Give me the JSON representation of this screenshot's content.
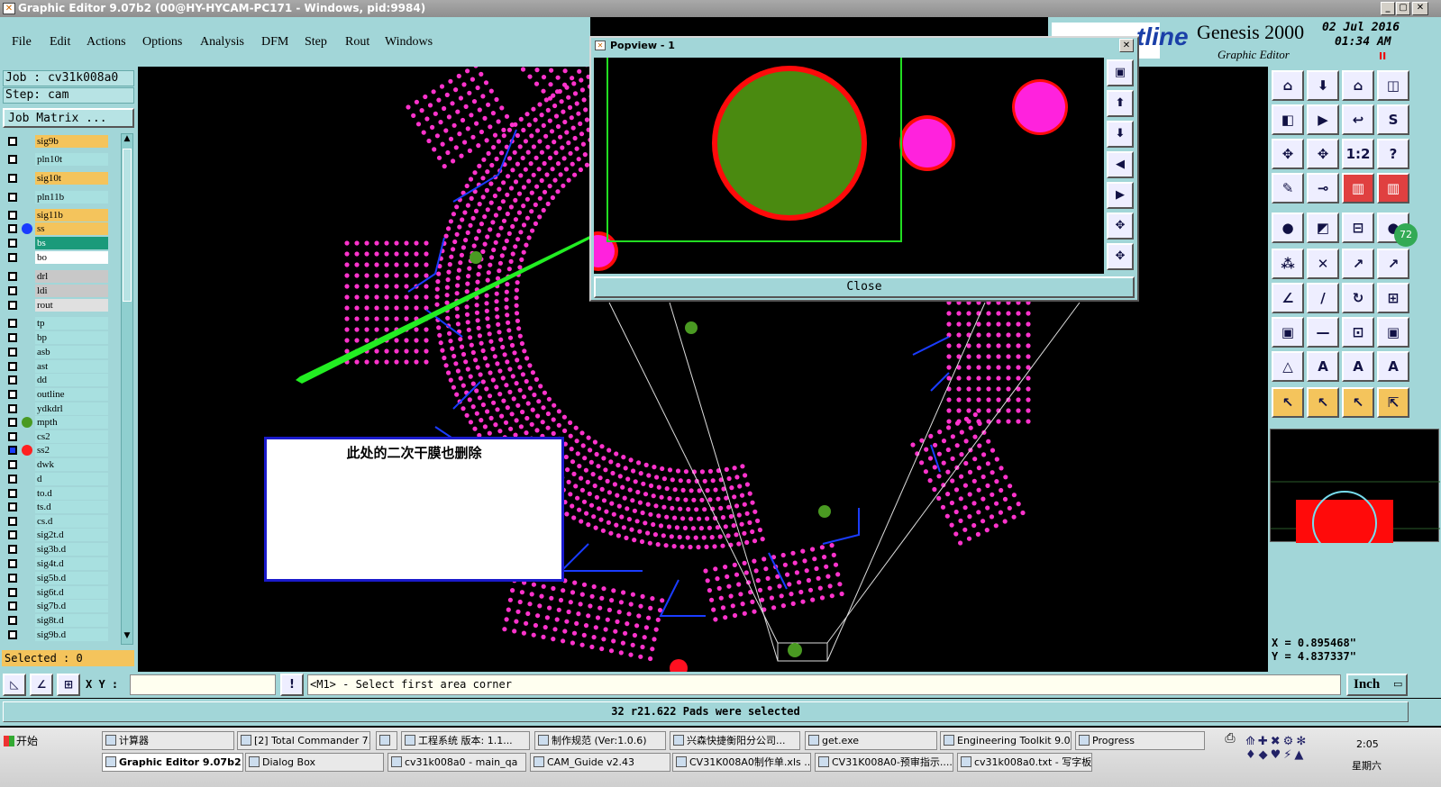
{
  "window": {
    "title": "Graphic Editor 9.07b2 (00@HY-HYCAM-PC171 - Windows, pid:9984)",
    "min": "_",
    "max": "▢",
    "close": "✕"
  },
  "menu": [
    "File",
    "Edit",
    "Actions",
    "Options",
    "Analysis",
    "DFM",
    "Step",
    "Rout",
    "Windows"
  ],
  "brand": {
    "logo": "tline",
    "product": "Genesis 2000",
    "subtitle": "Graphic Editor",
    "date": "02 Jul 2016",
    "time": "01:34 AM",
    "pause": "II"
  },
  "job": {
    "job_label": "Job : cv31k008a0",
    "step_label": "Step: cam",
    "matrix_button": "Job Matrix ..."
  },
  "layers": [
    {
      "name": "sig9b",
      "color": "#f4c45c",
      "dot": ""
    },
    {
      "name": "pln10t",
      "color": "#a8e0e0",
      "dot": ""
    },
    {
      "name": "sig10t",
      "color": "#f4c45c",
      "dot": ""
    },
    {
      "name": "pln11b",
      "color": "#a8e0e0",
      "dot": ""
    },
    {
      "name": "sig11b",
      "color": "#f4c45c",
      "dot": ""
    },
    {
      "name": "ss",
      "color": "#f4c45c",
      "dot": "#1a3cff"
    },
    {
      "name": "bs",
      "color": "#1a9a7a",
      "dot": ""
    },
    {
      "name": "bo",
      "color": "#ffffff",
      "dot": ""
    },
    {
      "name": "drl",
      "color": "#c8c8c8",
      "dot": ""
    },
    {
      "name": "ldi",
      "color": "#c8c8c8",
      "dot": ""
    },
    {
      "name": "rout",
      "color": "#e0e0e0",
      "dot": ""
    },
    {
      "name": "tp",
      "color": "#a8e0e0",
      "dot": ""
    },
    {
      "name": "bp",
      "color": "#a8e0e0",
      "dot": ""
    },
    {
      "name": "asb",
      "color": "#a8e0e0",
      "dot": ""
    },
    {
      "name": "ast",
      "color": "#a8e0e0",
      "dot": ""
    },
    {
      "name": "dd",
      "color": "#a8e0e0",
      "dot": ""
    },
    {
      "name": "outline",
      "color": "#a8e0e0",
      "dot": ""
    },
    {
      "name": "ydkdrl",
      "color": "#a8e0e0",
      "dot": ""
    },
    {
      "name": "mpth",
      "color": "#a8e0e0",
      "dot": "#4a9a22"
    },
    {
      "name": "cs2",
      "color": "#a8e0e0",
      "dot": ""
    },
    {
      "name": "ss2",
      "color": "#a8e0e0",
      "dot": "#ff2020"
    },
    {
      "name": "dwk",
      "color": "#a8e0e0",
      "dot": ""
    },
    {
      "name": "d",
      "color": "#a8e0e0",
      "dot": ""
    },
    {
      "name": "to.d",
      "color": "#a8e0e0",
      "dot": ""
    },
    {
      "name": "ts.d",
      "color": "#a8e0e0",
      "dot": ""
    },
    {
      "name": "cs.d",
      "color": "#a8e0e0",
      "dot": ""
    },
    {
      "name": "sig2t.d",
      "color": "#a8e0e0",
      "dot": ""
    },
    {
      "name": "sig3b.d",
      "color": "#a8e0e0",
      "dot": ""
    },
    {
      "name": "sig4t.d",
      "color": "#a8e0e0",
      "dot": ""
    },
    {
      "name": "sig5b.d",
      "color": "#a8e0e0",
      "dot": ""
    },
    {
      "name": "sig6t.d",
      "color": "#a8e0e0",
      "dot": ""
    },
    {
      "name": "sig7b.d",
      "color": "#a8e0e0",
      "dot": ""
    },
    {
      "name": "sig8t.d",
      "color": "#a8e0e0",
      "dot": ""
    },
    {
      "name": "sig9b.d",
      "color": "#a8e0e0",
      "dot": ""
    }
  ],
  "selected_label": "Selected : 0",
  "popview": {
    "title": "Popview - 1",
    "close_label": "Close",
    "x_glyph": "✕"
  },
  "annotation": {
    "text": "此处的二次干膜也删除",
    "text_color": "#d4147a"
  },
  "coords": {
    "x": "X = 0.895468\"",
    "y": "Y = 4.837337\""
  },
  "badge": "72",
  "command": {
    "xy_label": "X Y :",
    "xy_value": "",
    "prompt": "<M1> - Select first area corner",
    "units": "Inch",
    "units_arrow": "▭"
  },
  "status": "32 r21.622 Pads were selected",
  "toolbar_rows": [
    [
      "⌂",
      "⬇",
      "⌂",
      "◫"
    ],
    [
      "◧",
      "▶",
      "↩",
      "S"
    ],
    [
      "✥",
      "✥",
      "1:2",
      "?"
    ],
    [
      "✎",
      "⊸",
      "▥",
      "▥"
    ],
    [
      "●",
      "◩",
      "⊟",
      "●"
    ],
    [
      "⁂",
      "✕",
      "↗",
      "↗"
    ],
    [
      "∠",
      "/",
      "↻",
      "⊞"
    ],
    [
      "▣",
      "—",
      "⊡",
      "▣"
    ],
    [
      "△",
      "A",
      "A",
      "A"
    ],
    [
      "↖",
      "↖",
      "↖",
      "⇱"
    ]
  ],
  "taskbar": {
    "start": "开始",
    "clock": "2:05",
    "day": "星期六",
    "row1": [
      "计算器",
      "[2] Total Commander 7...",
      "",
      "工程系统  版本: 1.1...",
      "制作规范 (Ver:1.0.6)",
      "兴森快捷衡阳分公司...",
      "get.exe",
      "Engineering Toolkit 9.0...",
      "Progress"
    ],
    "row2": [
      "Graphic Editor 9.07b2 ...",
      "Dialog Box",
      "cv31k008a0 - main_qa",
      "CAM_Guide v2.43",
      "CV31K008A0制作单.xls ...",
      "CV31K008A0-预审指示....",
      "cv31k008a0.txt - 写字板"
    ]
  },
  "colors": {
    "panel": "#a2d6d8",
    "pad": "#ff33cc",
    "trace": "#1a3cff",
    "highlight_pad": "#4a9a22",
    "arrow": "#22ee22"
  }
}
